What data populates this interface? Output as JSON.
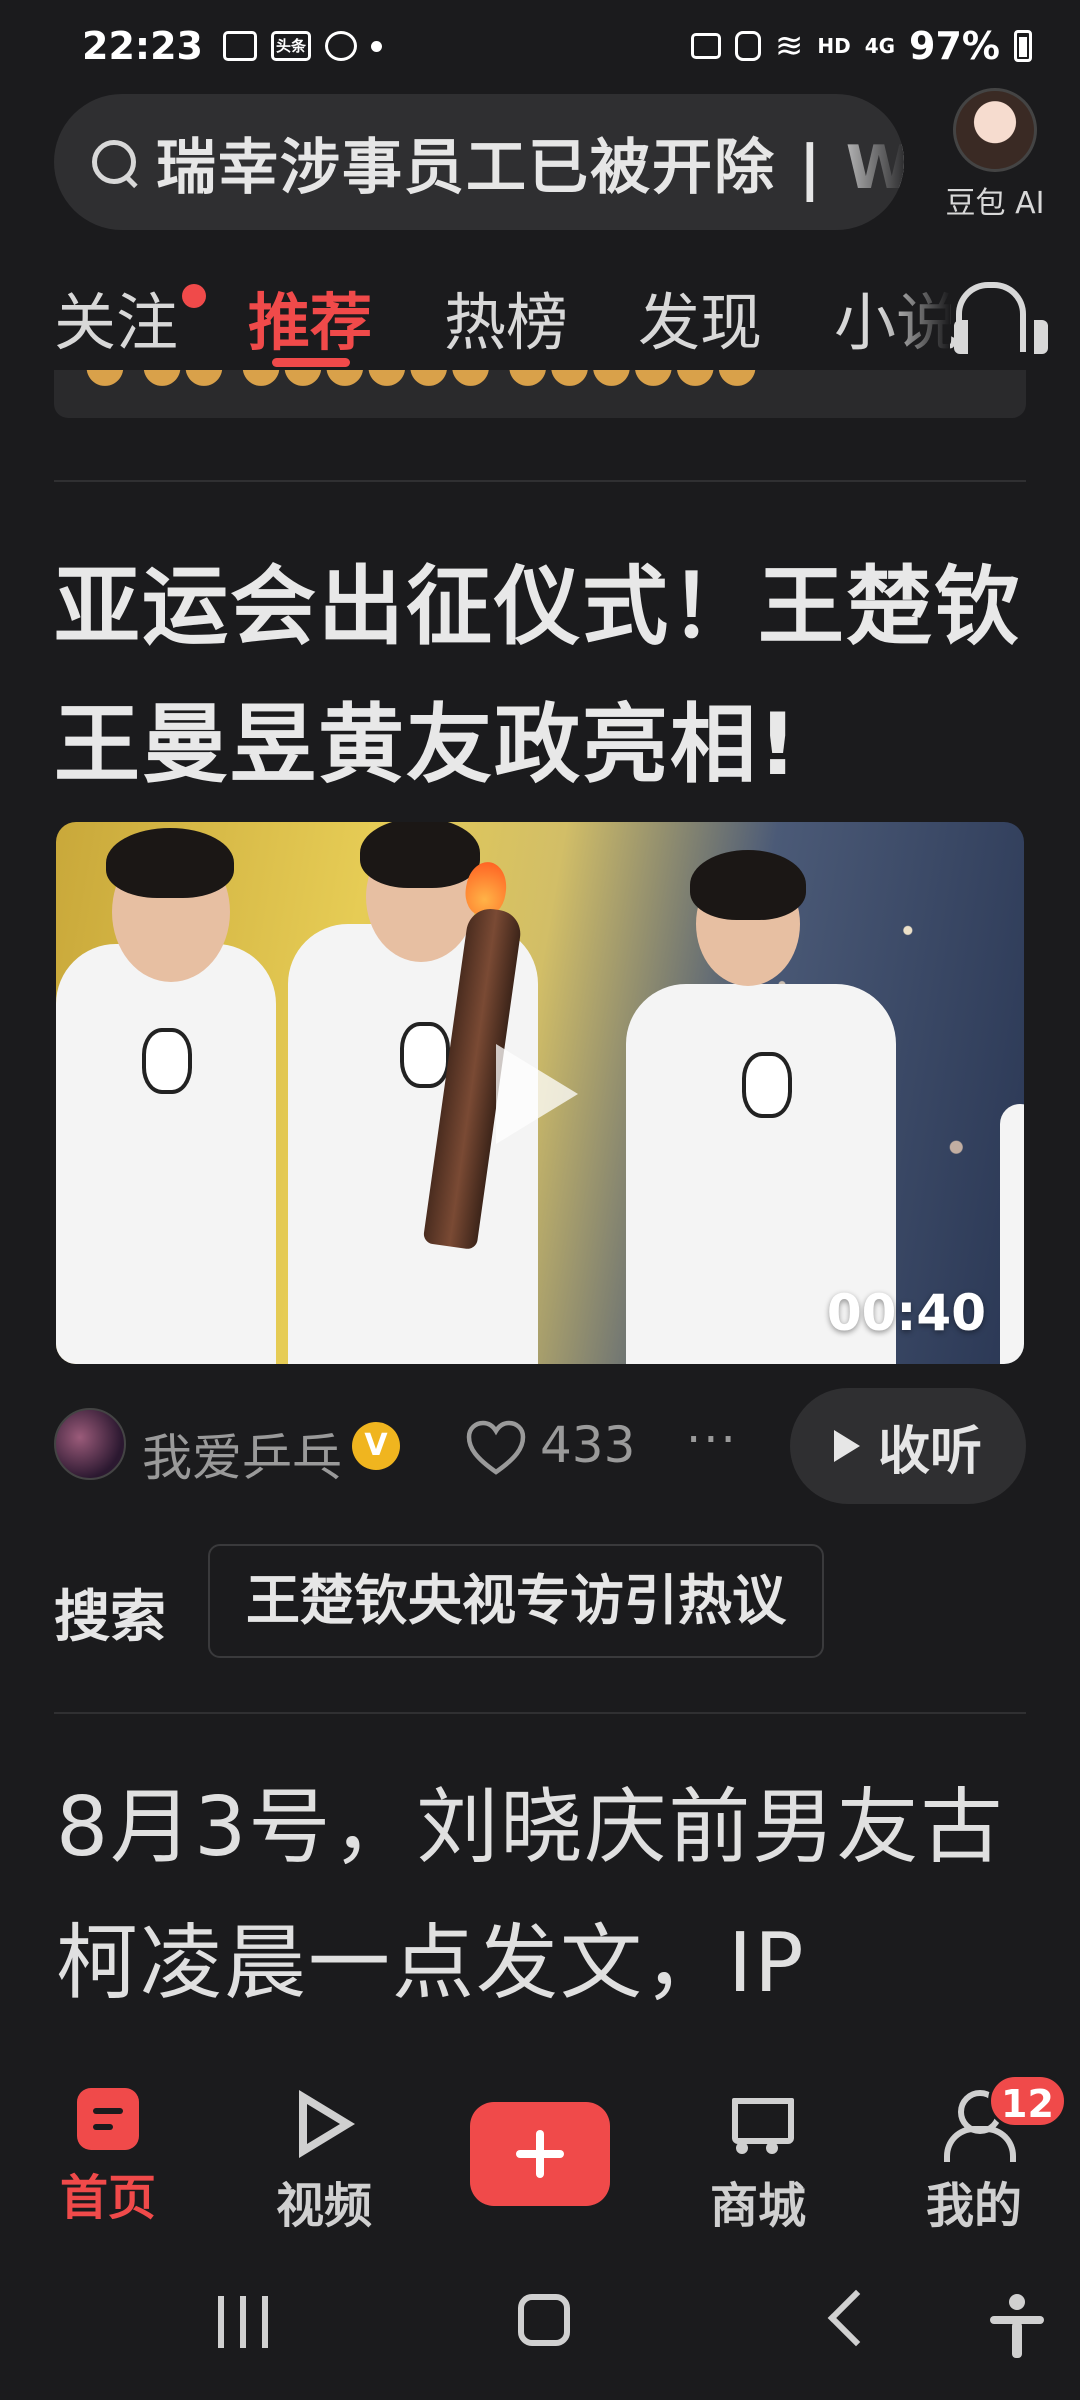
{
  "status_bar": {
    "time": "22:23",
    "left_icons": [
      "gallery-icon",
      "toutiao-icon",
      "weibo-icon"
    ],
    "toutiao_text": "头条",
    "network": "HD",
    "signal": "4G",
    "battery": "97%"
  },
  "header": {
    "search_text": "瑞幸涉事员工已被开除 | W",
    "assistant_label": "豆包 AI"
  },
  "tabs": [
    {
      "label": "关注",
      "has_dot": true
    },
    {
      "label": "推荐",
      "active": true
    },
    {
      "label": "热榜"
    },
    {
      "label": "发现"
    },
    {
      "label": "小说"
    }
  ],
  "article1": {
    "title": "亚运会出征仪式！王楚钦王曼昱黄友政亮相!",
    "duration": "00:40",
    "author": "我爱乒乓",
    "verified": "V",
    "likes": "433",
    "listen_label": "收听"
  },
  "search_suggestion": {
    "label": "搜索",
    "query": "王楚钦央视专访引热议"
  },
  "article2": {
    "text": "8月3号，刘晓庆前男友古柯凌晨一点发文，IP"
  },
  "bottom_nav": {
    "items": [
      {
        "label": "首页",
        "active": true
      },
      {
        "label": "视频"
      },
      {
        "label": "商城"
      },
      {
        "label": "我的"
      }
    ],
    "badge": "12"
  },
  "colors": {
    "accent": "#f04a4a",
    "background": "#1b1b1d",
    "verified": "#f0b51f"
  }
}
